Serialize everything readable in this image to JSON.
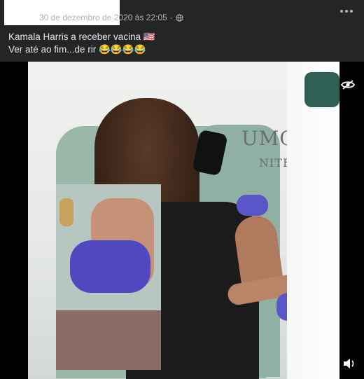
{
  "post": {
    "timestamp": "30 de dezembro de 2020 às 22:05",
    "caption_line1": "Kamala Harris a receber vacina 🇺🇸",
    "caption_line2": "Ver até ao fim...de rir 😂😂😂😂",
    "more_icon": "more-options-icon",
    "privacy_icon": "globe-icon"
  },
  "video": {
    "logo_text_1": "UMC",
    "logo_text_2": "NITED",
    "hide_icon": "eye-hidden-icon",
    "sound_icon": "volume-icon"
  },
  "colors": {
    "background": "#242526",
    "text": "#e4e6eb",
    "secondary_text": "#b0b3b8"
  }
}
